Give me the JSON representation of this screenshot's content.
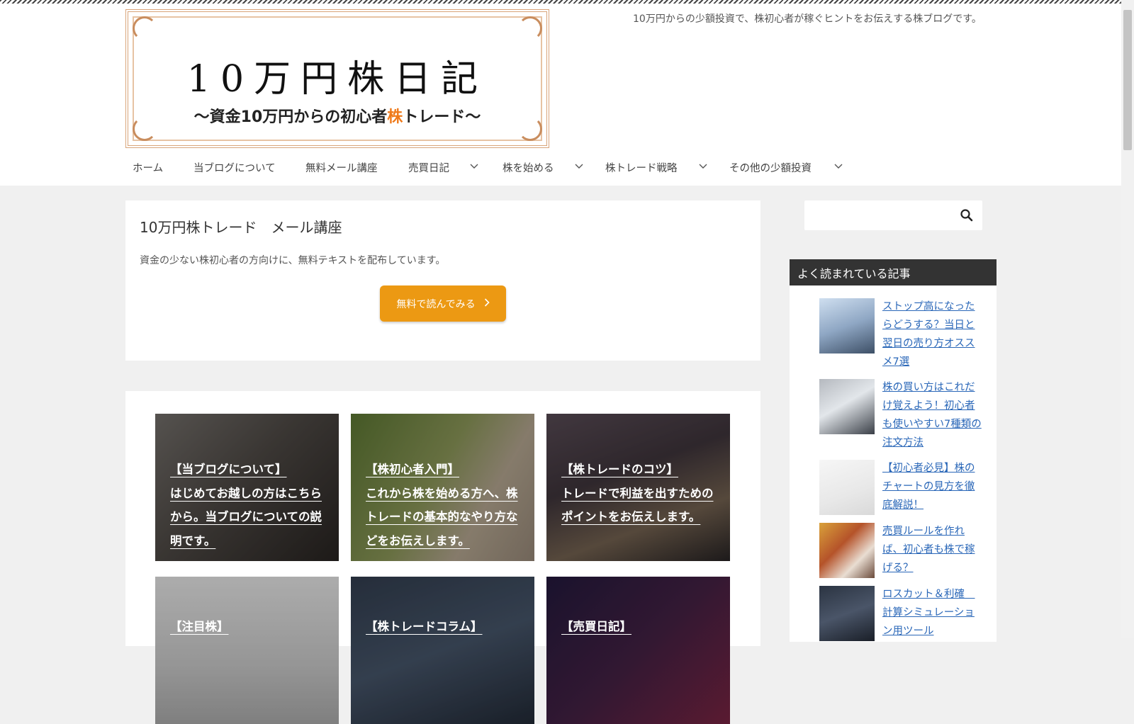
{
  "site": {
    "logo_title": "10万円株日記",
    "logo_sub_before": "〜資金10万円からの初心者",
    "logo_sub_highlight": "株",
    "logo_sub_after": "トレード〜",
    "tagline": "10万円からの少額投資で、株初心者が稼ぐヒントをお伝えする株ブログです。"
  },
  "nav": {
    "items": [
      {
        "label": "ホーム",
        "has_dropdown": false
      },
      {
        "label": "当ブログについて",
        "has_dropdown": false
      },
      {
        "label": "無料メール講座",
        "has_dropdown": false
      },
      {
        "label": "売買日記",
        "has_dropdown": true
      },
      {
        "label": "株を始める",
        "has_dropdown": true
      },
      {
        "label": "株トレード戦略",
        "has_dropdown": true
      },
      {
        "label": "その他の少額投資",
        "has_dropdown": true
      }
    ]
  },
  "mail_course": {
    "title": "10万円株トレード　メール講座",
    "description": "資金の少ない株初心者の方向けに、無料テキストを配布しています。",
    "button_label": "無料で読んでみる"
  },
  "tiles": [
    {
      "title": "【当ブログについて】",
      "text": "はじめてお越しの方はこちらから。当ブログについての説明です。"
    },
    {
      "title": "【株初心者入門】",
      "text": "これから株を始める方へ、株トレードの基本的なやり方などをお伝えします。"
    },
    {
      "title": "【株トレードのコツ】",
      "text": "トレードで利益を出すためのポイントをお伝えします。"
    },
    {
      "title": "【注目株】",
      "text": ""
    },
    {
      "title": "【株トレードコラム】",
      "text": ""
    },
    {
      "title": "【売買日記】",
      "text": ""
    }
  ],
  "sidebar": {
    "search_placeholder": "",
    "popular_heading": "よく読まれている記事",
    "popular_items": [
      {
        "title": "ストップ高になったらどうする？当日と翌日の売り方オススメ7選",
        "thumb": "spiral-staircase-image"
      },
      {
        "title": "株の買い方はこれだけ覚えよう！初心者も使いやすい7種類の注文方法",
        "thumb": "computer-chart-image"
      },
      {
        "title": "【初心者必見】株のチャートの見方を徹底解説！",
        "thumb": "chart-sketch-image"
      },
      {
        "title": "売買ルールを作れば、初心者も株で稼げる？",
        "thumb": "rules-note-image"
      },
      {
        "title": "ロスカット＆利確　計算シミュレーション用ツール",
        "thumb": "profit-loss-image"
      }
    ]
  },
  "colors": {
    "accent_orange": "#ec9913",
    "link_blue": "#2a67b8",
    "sidebar_heading_bg": "#333333"
  }
}
